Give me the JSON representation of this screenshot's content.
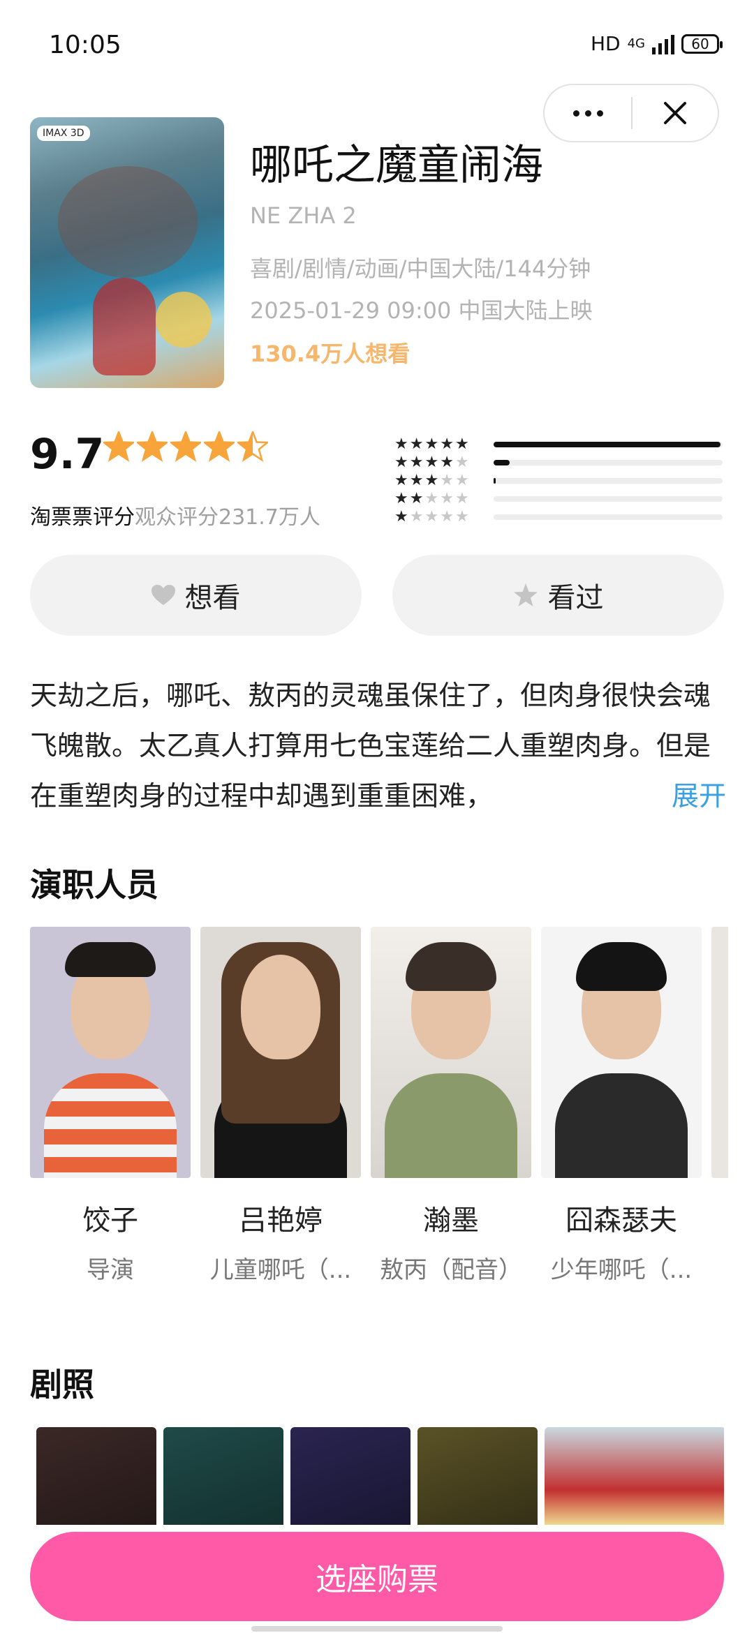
{
  "status_bar": {
    "time": "10:05",
    "hd": "HD",
    "network": "4G",
    "battery": "60"
  },
  "movie": {
    "poster_badge": "IMAX 3D",
    "title": "哪吒之魔童闹海",
    "en_title": "NE ZHA 2",
    "genres": "喜剧/剧情/动画/中国大陆/144分钟",
    "release": "2025-01-29 09:00 中国大陆上映",
    "want_count": "130.4万人想看"
  },
  "rating": {
    "score": "9.7",
    "stars": 4.5,
    "source_label": "淘票票评分",
    "audience_label": "观众评分231.7万人",
    "distribution": [
      {
        "stars": 5,
        "fraction": 0.99
      },
      {
        "stars": 4,
        "fraction": 0.07
      },
      {
        "stars": 3,
        "fraction": 0.01
      },
      {
        "stars": 2,
        "fraction": 0.0
      },
      {
        "stars": 1,
        "fraction": 0.0
      }
    ]
  },
  "actions": {
    "want": "想看",
    "watched": "看过"
  },
  "synopsis": {
    "text": "天劫之后，哪吒、敖丙的灵魂虽保住了，但肉身很快会魂飞魄散。太乙真人打算用七色宝莲给二人重塑肉身。但是在重塑肉身的过程中却遇到重重困难，",
    "expand": "展开"
  },
  "cast": {
    "heading": "演职人员",
    "people": [
      {
        "name": "饺子",
        "role": "导演"
      },
      {
        "name": "吕艳婷",
        "role": "儿童哪吒（..."
      },
      {
        "name": "瀚墨",
        "role": "敖丙（配音）"
      },
      {
        "name": "囧森瑟夫",
        "role": "少年哪吒（..."
      }
    ]
  },
  "stills": {
    "heading": "剧照"
  },
  "buy_button": "选座购票",
  "colors": {
    "accent_pink": "#ff5aa8",
    "want_orange": "#f6b66b",
    "star_orange": "#f7a53a",
    "link_blue": "#3aa0e0"
  },
  "icons": [
    "more-icon",
    "close-icon",
    "heart-icon",
    "star-icon"
  ]
}
